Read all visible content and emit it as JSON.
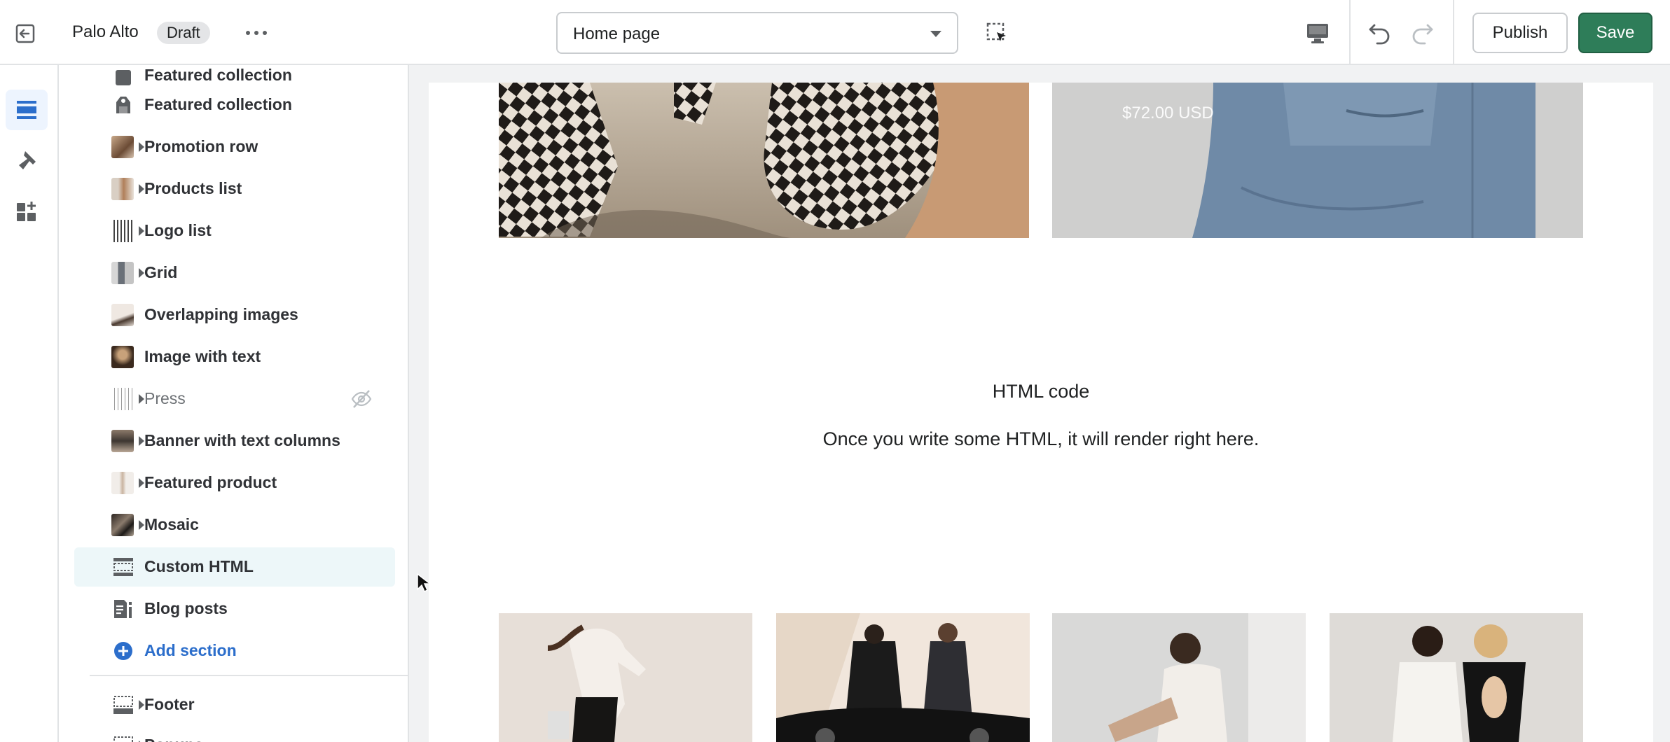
{
  "topbar": {
    "store_name": "Palo Alto",
    "status_badge": "Draft",
    "page_select": "Home page",
    "publish_label": "Publish",
    "save_label": "Save"
  },
  "rail": {
    "items": [
      "sections-icon",
      "theme-settings-icon",
      "app-embeds-icon"
    ]
  },
  "sidebar": {
    "cut_top_label": "Featured collection",
    "sections": [
      {
        "label": "Featured collection",
        "expandable": false
      },
      {
        "label": "Promotion row",
        "expandable": true
      },
      {
        "label": "Products list",
        "expandable": true
      },
      {
        "label": "Logo list",
        "expandable": true
      },
      {
        "label": "Grid",
        "expandable": true
      },
      {
        "label": "Overlapping images",
        "expandable": false
      },
      {
        "label": "Image with text",
        "expandable": false
      },
      {
        "label": "Press",
        "expandable": true,
        "hidden": true
      },
      {
        "label": "Banner with text columns",
        "expandable": true
      },
      {
        "label": "Featured product",
        "expandable": true
      },
      {
        "label": "Mosaic",
        "expandable": true
      },
      {
        "label": "Custom HTML",
        "expandable": false,
        "selected": true
      },
      {
        "label": "Blog posts",
        "expandable": false
      }
    ],
    "add_section": "Add section",
    "footer_label": "Footer",
    "cut_bottom_label": "Popups"
  },
  "preview": {
    "price": "$72.00 USD",
    "html_title": "HTML code",
    "html_subtitle": "Once you write some HTML, it will render right here."
  },
  "colors": {
    "accent_blue": "#2c6ecb",
    "save_green": "#2e7d59",
    "selected_row": "#edf7f9"
  }
}
